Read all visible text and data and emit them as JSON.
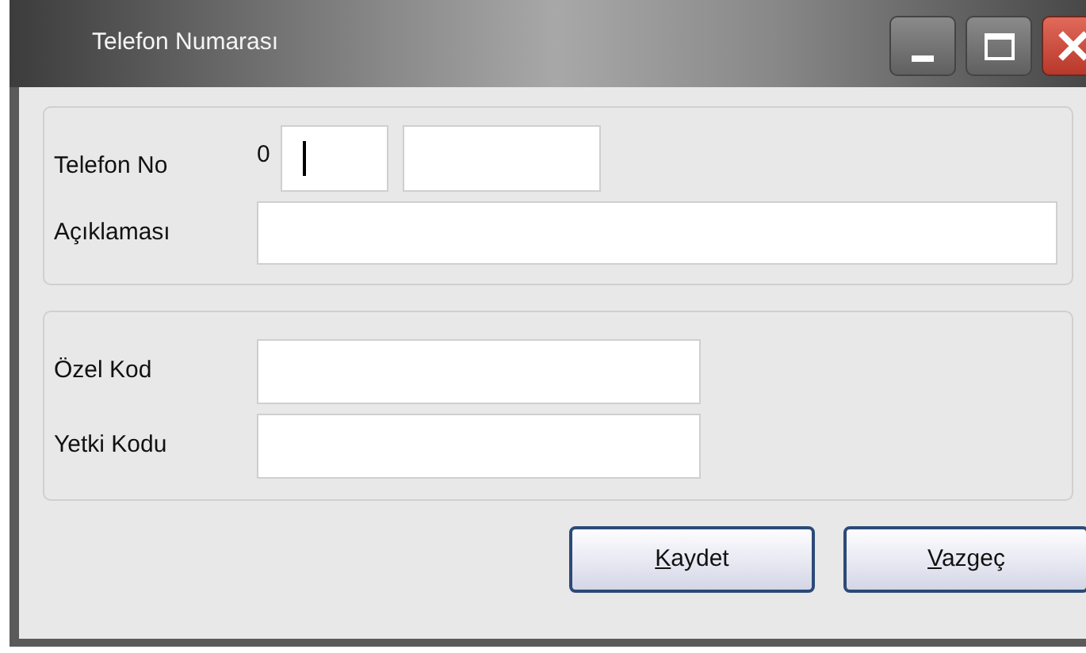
{
  "window": {
    "title": "Telefon Numarası"
  },
  "phone_group": {
    "label": "Telefon No",
    "prefix": "0",
    "fields": [
      {
        "focused": true
      },
      {
        "focused": false
      }
    ]
  },
  "description": {
    "label": "Açıklaması"
  },
  "codes": [
    {
      "label": "Özel Kod"
    },
    {
      "label": "Yetki Kodu"
    }
  ],
  "buttons": [
    {
      "mnemonic": "K",
      "rest": "aydet"
    },
    {
      "mnemonic": "V",
      "rest": "azgeç"
    }
  ]
}
